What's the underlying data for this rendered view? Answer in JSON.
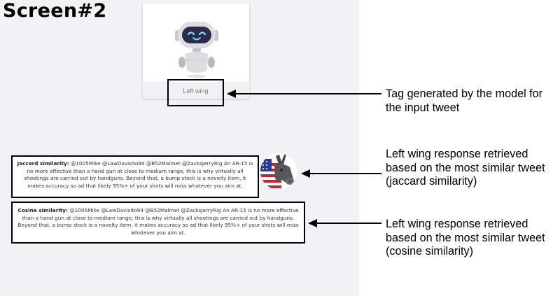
{
  "screen_title": "Screen#2",
  "bot_card": {
    "tag_label": "Left wing"
  },
  "responses": [
    {
      "label": "Jaccard similarity:",
      "text": "@1005Mike @LawDavisito94 @B52Malmet @ZacksJerryRig An AR-15 is no more effective than a hand gun at close to medium range, this is why virtually all shootings are carried out by handguns. Beyond that, a bump stock is a novelty item, it makes accuracy so ad that likely 95%+ of your shots will miss whatever you aim at."
    },
    {
      "label": "Cosine similarity:",
      "text": "@1005Mike @LawDavisito94 @B52Malmet @ZacksJerryRig An AR-15 is no more effective than a hand gun at close to medium range, this is why virtually all shootings are carried out by handguns. Beyond that, a bump stock is a novelty item, it makes accuracy so ad that likely 95%+ of your shots will miss whatever you aim at."
    }
  ],
  "annotations": [
    "Tag generated by the model for the input tweet",
    "Left wing response retrieved based on the most similar tweet (jaccard similarity)",
    "Left wing response retrieved based on the most similar tweet (cosine similarity)"
  ],
  "icons": {
    "bot": "robot-icon",
    "avatar": "democrat-donkey-icon"
  },
  "colors": {
    "panel_bg": "#f2f2f4",
    "robot_visor": "#2a2d4a",
    "robot_eyes": "#7fe0ff",
    "flag_red": "#c0272d",
    "flag_blue": "#2a3a8c"
  }
}
